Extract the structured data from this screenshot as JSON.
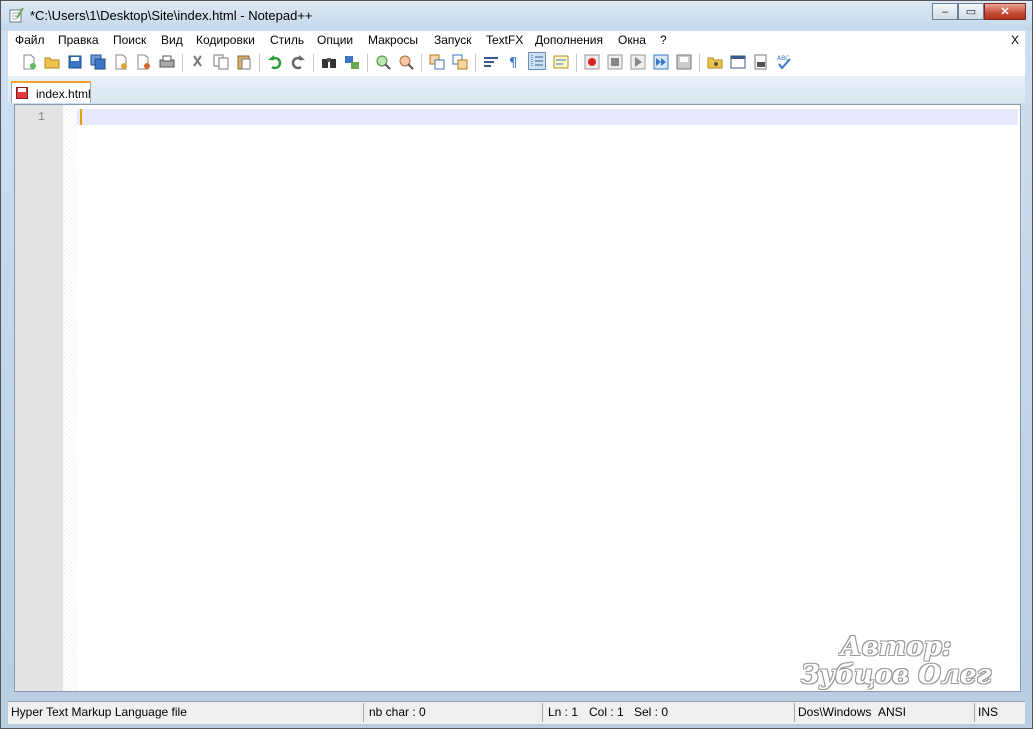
{
  "window": {
    "title": "*C:\\Users\\1\\Desktop\\Site\\index.html - Notepad++",
    "minimize": "–",
    "maximize": "▭",
    "close": "✕"
  },
  "menu": {
    "items": [
      "Файл",
      "Правка",
      "Поиск",
      "Вид",
      "Кодировки",
      "Стиль",
      "Опции",
      "Макросы",
      "Запуск",
      "TextFX",
      "Дополнения",
      "Окна",
      "?"
    ],
    "close_label": "X"
  },
  "toolbar": {
    "icons": [
      "new-file-icon",
      "open-file-icon",
      "save-icon",
      "save-all-icon",
      "close-icon",
      "close-all-icon",
      "print-icon",
      "cut-icon",
      "copy-icon",
      "paste-icon",
      "undo-icon",
      "redo-icon",
      "find-icon",
      "replace-icon",
      "zoom-in-icon",
      "zoom-out-icon",
      "sync-vertical-icon",
      "sync-horizontal-icon",
      "word-wrap-icon",
      "show-all-chars-icon",
      "indent-guide-icon",
      "user-lang-icon",
      "record-macro-icon",
      "stop-record-icon",
      "play-macro-icon",
      "run-macro-multiple-icon",
      "save-macro-icon",
      "open-folder-icon",
      "console-icon",
      "preview-icon",
      "spellcheck-icon"
    ]
  },
  "tabs": [
    {
      "label": "index.html"
    }
  ],
  "editor": {
    "line_numbers": [
      "1"
    ],
    "content": ""
  },
  "watermark": {
    "line1": "Автор:",
    "line2": "Зубцов Олег"
  },
  "status": {
    "file_type": "Hyper Text Markup Language file",
    "nb_char": "nb char : 0",
    "ln": "Ln : 1",
    "col": "Col : 1",
    "sel": "Sel : 0",
    "eol": "Dos\\Windows",
    "encoding": "ANSI",
    "mode": "INS"
  },
  "colors": {
    "tab_accent": "#f3a22a",
    "current_line": "#e8e8ff",
    "caret": "#e0a000"
  }
}
